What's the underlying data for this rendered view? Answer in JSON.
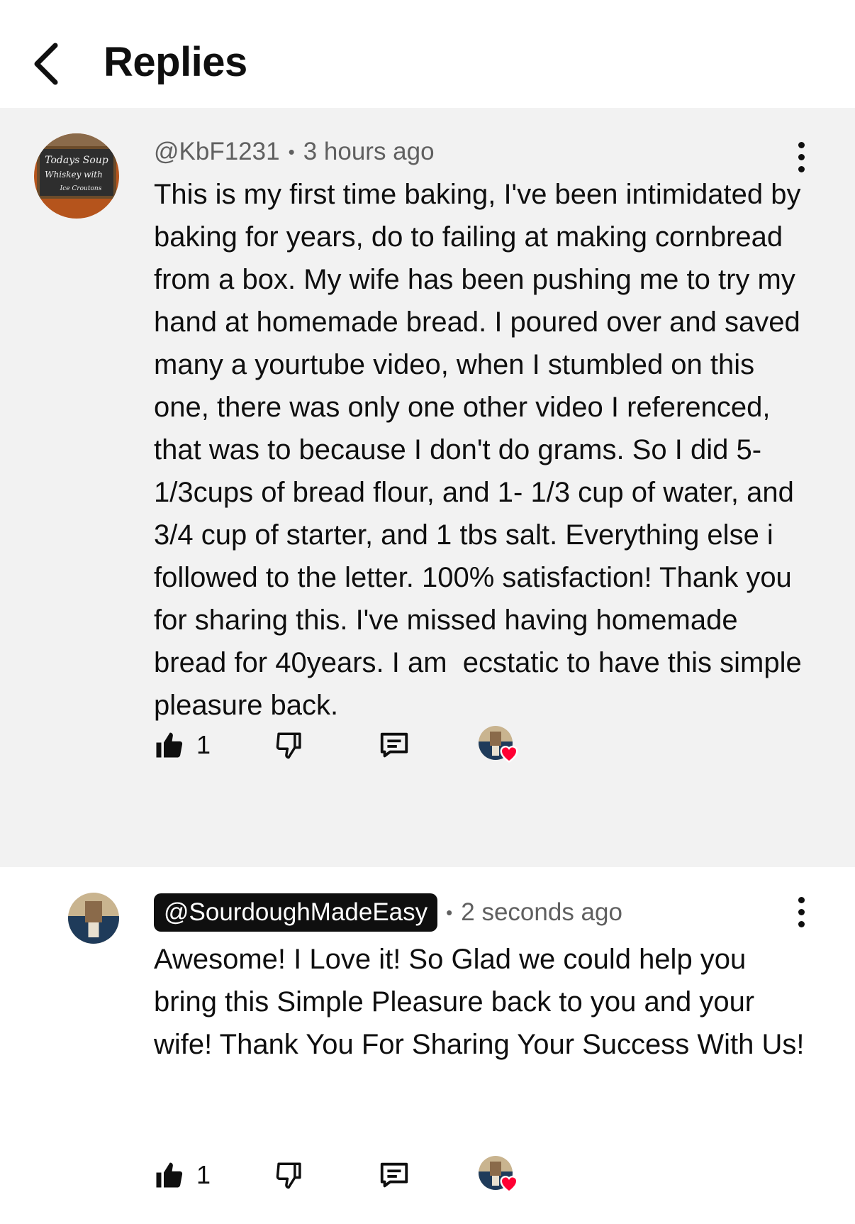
{
  "header": {
    "title": "Replies",
    "back_icon": "chevron-left-icon"
  },
  "comment": {
    "author": "@KbF1231",
    "time": "3 hours ago",
    "avatar_text": [
      "Todays Soup",
      "Whiskey with",
      "Ice Croutons"
    ],
    "text": "This is my first time baking, I've been intimidated by baking for years, do to failing at making cornbread from a box. My wife has been pushing me to try my hand at homemade bread. I poured over and saved many a yourtube video, when I stumbled on this one, there was only one other video I referenced, that was to because I don't do grams. So I did 5-1/3cups of bread flour, and 1- 1/3 cup of water, and 3/4 cup of starter, and 1 tbs salt. Everything else i followed to the letter. 100% satisfaction! Thank you for sharing this. I've missed having homemade bread for 40years. I am  ecstatic to have this simple pleasure back.",
    "likes": "1"
  },
  "reply": {
    "author": "@SourdoughMadeEasy",
    "time": "2 seconds ago",
    "text": "Awesome! I Love it! So Glad we could help you bring this Simple Pleasure back to you and your wife! Thank You For Sharing Your Success With Us!",
    "likes": "1"
  },
  "colors": {
    "heart": "#ff0033",
    "thread_bg": "#f2f2f2",
    "badge_bg": "#0f0f0f"
  }
}
